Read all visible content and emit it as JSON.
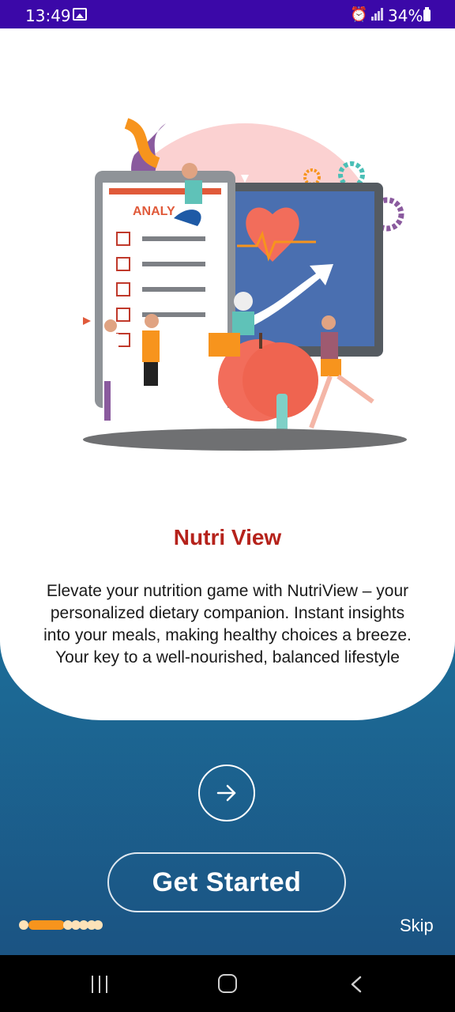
{
  "status_bar": {
    "time": "13:49",
    "battery": "34%",
    "icons": [
      "gallery-icon",
      "alarm-icon",
      "signal-icon",
      "battery-icon"
    ]
  },
  "onboarding": {
    "title": "Nutri View",
    "description": "Elevate your nutrition game with NutriView – your personalized dietary companion. Instant insights into your meals, making healthy choices a breeze. Your key to a well-nourished, balanced lifestyle",
    "illustration_label": "ANALY",
    "next_icon": "arrow-right-icon",
    "get_started_label": "Get Started",
    "skip_label": "Skip",
    "page_indicator": {
      "total": 5,
      "current": 1
    }
  },
  "colors": {
    "title": "#b5221b",
    "status_bar": "#3b08a8",
    "indicator_active": "#f7941d",
    "indicator_inactive": "#fde2b8",
    "gradient_top": "#1d9ab6",
    "gradient_bottom": "#1b4f7f"
  },
  "nav_bar": {
    "icons": [
      "recent-apps-icon",
      "home-icon",
      "back-icon"
    ]
  }
}
